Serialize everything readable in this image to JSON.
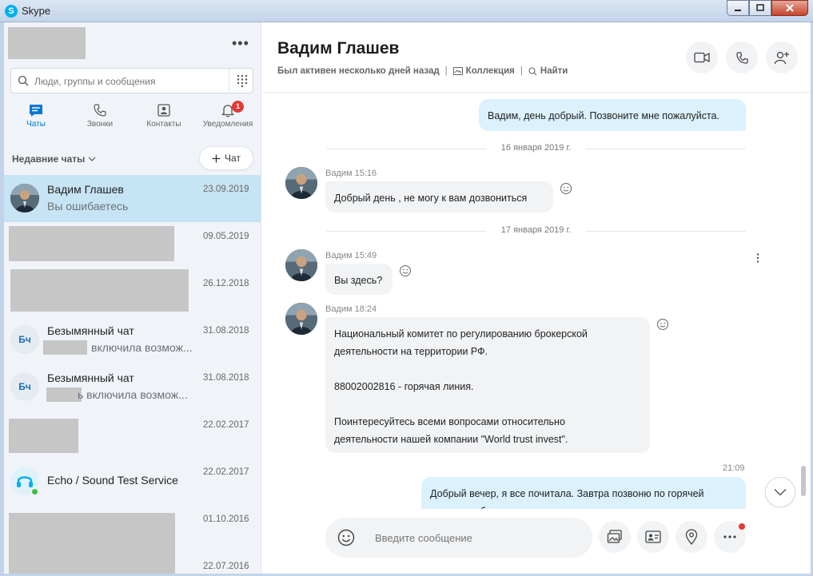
{
  "window": {
    "title": "Skype",
    "app_icon_letter": "S"
  },
  "sidebar": {
    "more_label": "•••",
    "search_placeholder": "Люди, группы и сообщения",
    "nav": [
      {
        "label": "Чаты",
        "icon": "chat-icon"
      },
      {
        "label": "Звонки",
        "icon": "phone-icon"
      },
      {
        "label": "Контакты",
        "icon": "contacts-icon"
      },
      {
        "label": "Уведомления",
        "icon": "bell-icon",
        "badge": "1"
      }
    ],
    "recent_label": "Недавние чаты",
    "new_chat_label": "Чат",
    "chats": [
      {
        "name": "Вадим Глашев",
        "preview": "Вы ошибаетесь",
        "date": "23.09.2019"
      },
      {
        "name": "",
        "preview": "",
        "date": "09.05.2019"
      },
      {
        "name": "",
        "preview": "",
        "date": "26.12.2018"
      },
      {
        "name": "Безымянный чат",
        "preview": "включила возмож...",
        "date": "31.08.2018",
        "initials": "Бч"
      },
      {
        "name": "Безымянный чат",
        "preview": "ь включила возмож...",
        "date": "31.08.2018",
        "initials": "Бч"
      },
      {
        "name": "",
        "preview": "",
        "date": "22.02.2017"
      },
      {
        "name": "Echo / Sound Test Service",
        "preview": "",
        "date": "22.02.2017"
      },
      {
        "name": "",
        "preview": "",
        "date": "01.10.2016"
      },
      {
        "name": "",
        "preview": "",
        "date": "22.07.2016"
      }
    ]
  },
  "conversation": {
    "contact_name": "Вадим Глашев",
    "status": "Был активен несколько дней назад",
    "gallery_label": "Коллекция",
    "find_label": "Найти",
    "messages": {
      "out1": "Вадим, день добрый. Позвоните мне пожалуйста.",
      "date1": "16 января 2019 г.",
      "in1_meta": "Вадим 15:16",
      "in1": "Добрый день , не могу к вам дозвониться",
      "date2": "17 января 2019 г.",
      "in2_meta": "Вадим 15:49",
      "in2": "Вы здесь?",
      "in3_meta": "Вадим 18:24",
      "in3_p1": "Национальный комитет по регулированию брокерской",
      "in3_p2": "деятельности на территории РФ.",
      "in3_p3": "88002002816 - горячая линия.",
      "in3_p4": "Поинтересуйтесь всеми вопросами относительно",
      "in3_p5": "деятельности нашей компании \"World trust invest\".",
      "out2_time": "21:09",
      "out2_l1": "Добрый вечер, я все почитала. Завтра позвоню по горячей",
      "out2_l2": "линии, пообщаюсь"
    },
    "composer_placeholder": "Введите сообщение"
  },
  "colors": {
    "accent": "#0078d4",
    "bubble_out": "#dbf1fd",
    "bubble_in": "#f1f3f5",
    "active_chat": "#c7e4f4"
  }
}
